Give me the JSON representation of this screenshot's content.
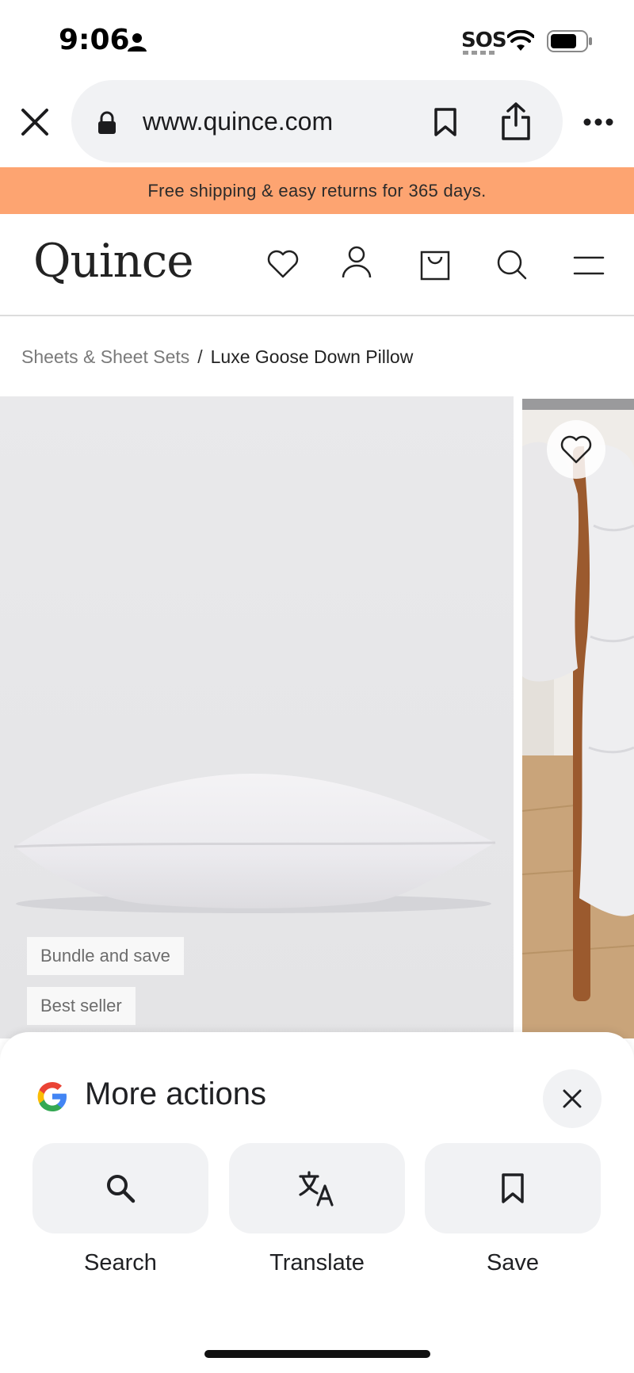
{
  "status_bar": {
    "time": "9:06",
    "sos": "SOS",
    "icons": [
      "person-icon",
      "wifi-icon",
      "battery-icon"
    ]
  },
  "browser": {
    "url": "www.quince.com",
    "icons": [
      "close-icon",
      "lock-icon",
      "bookmark-icon",
      "share-icon",
      "more-icon"
    ]
  },
  "promo_banner": {
    "text": "Free shipping & easy returns for 365 days.",
    "color": "#fda471"
  },
  "site_header": {
    "logo": "Quince",
    "icons": [
      "heart-icon",
      "account-icon",
      "bag-icon",
      "search-icon",
      "menu-icon"
    ]
  },
  "breadcrumb": {
    "parent": "Sheets & Sheet Sets",
    "separator": "/",
    "current": "Luxe Goose Down Pillow"
  },
  "product_gallery": {
    "badges": [
      "Bundle and save",
      "Best seller"
    ]
  },
  "more_actions_sheet": {
    "title": "More actions",
    "actions": [
      {
        "label": "Search",
        "icon": "search-icon"
      },
      {
        "label": "Translate",
        "icon": "translate-icon"
      },
      {
        "label": "Save",
        "icon": "bookmark-icon"
      }
    ]
  }
}
